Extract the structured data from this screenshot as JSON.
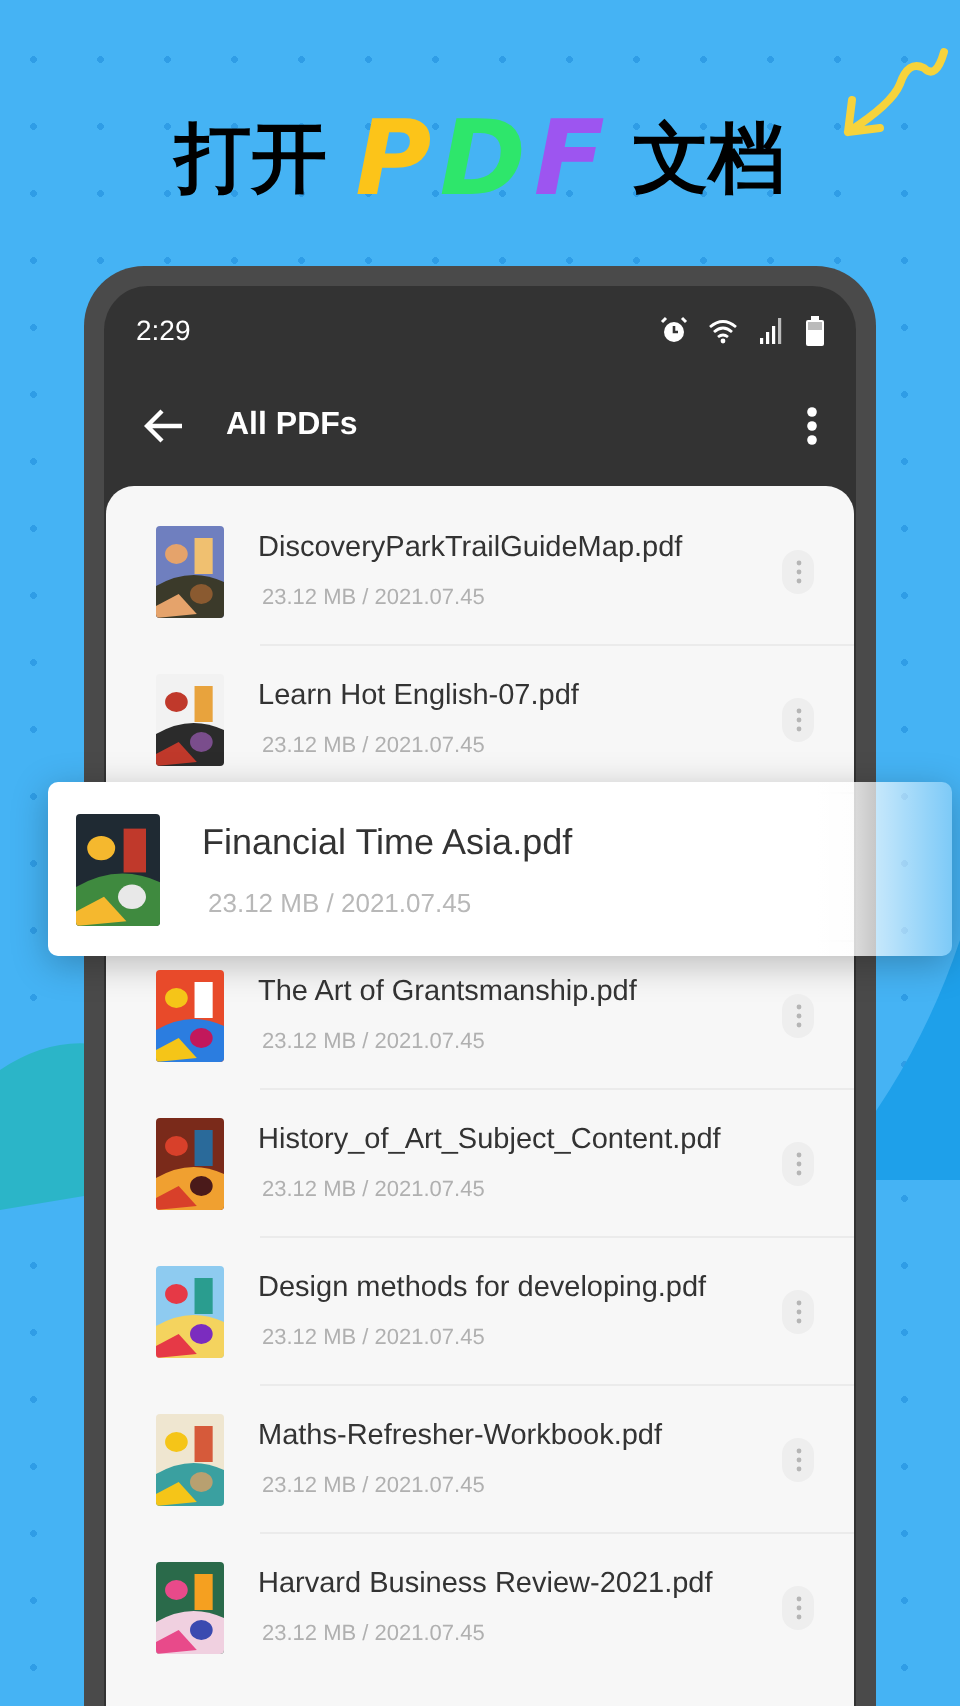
{
  "headline": [
    {
      "text": "打开",
      "kind": "plain"
    },
    {
      "text": "P",
      "kind": "accent",
      "color": "#fcc419"
    },
    {
      "text": "D",
      "kind": "accent",
      "color": "#2ee66b"
    },
    {
      "text": "F",
      "kind": "accent",
      "color": "#9d55f0"
    },
    {
      "text": "文档",
      "kind": "plain"
    }
  ],
  "status_bar": {
    "time": "2:29"
  },
  "toolbar": {
    "title": "All PDFs"
  },
  "files": [
    {
      "kind": "file",
      "name": "DiscoveryParkTrailGuideMap.pdf",
      "meta": "23.12 MB / 2021.07.45"
    },
    {
      "kind": "file",
      "name": "Learn Hot English-07.pdf",
      "meta": "23.12 MB / 2021.07.45"
    },
    {
      "kind": "dragged",
      "name": "Financial Time Asia.pdf",
      "meta": "23.12 MB / 2021.07.45"
    },
    {
      "kind": "file",
      "name": "The Art of Grantsmanship.pdf",
      "meta": "23.12 MB / 2021.07.45"
    },
    {
      "kind": "file",
      "name": "History_of_Art_Subject_Content.pdf",
      "meta": "23.12 MB / 2021.07.45"
    },
    {
      "kind": "file",
      "name": "Design methods for developing.pdf",
      "meta": "23.12 MB / 2021.07.45"
    },
    {
      "kind": "file",
      "name": "Maths-Refresher-Workbook.pdf",
      "meta": "23.12 MB / 2021.07.45"
    },
    {
      "kind": "file",
      "name": "Harvard Business Review-2021.pdf",
      "meta": "23.12 MB / 2021.07.45"
    }
  ]
}
